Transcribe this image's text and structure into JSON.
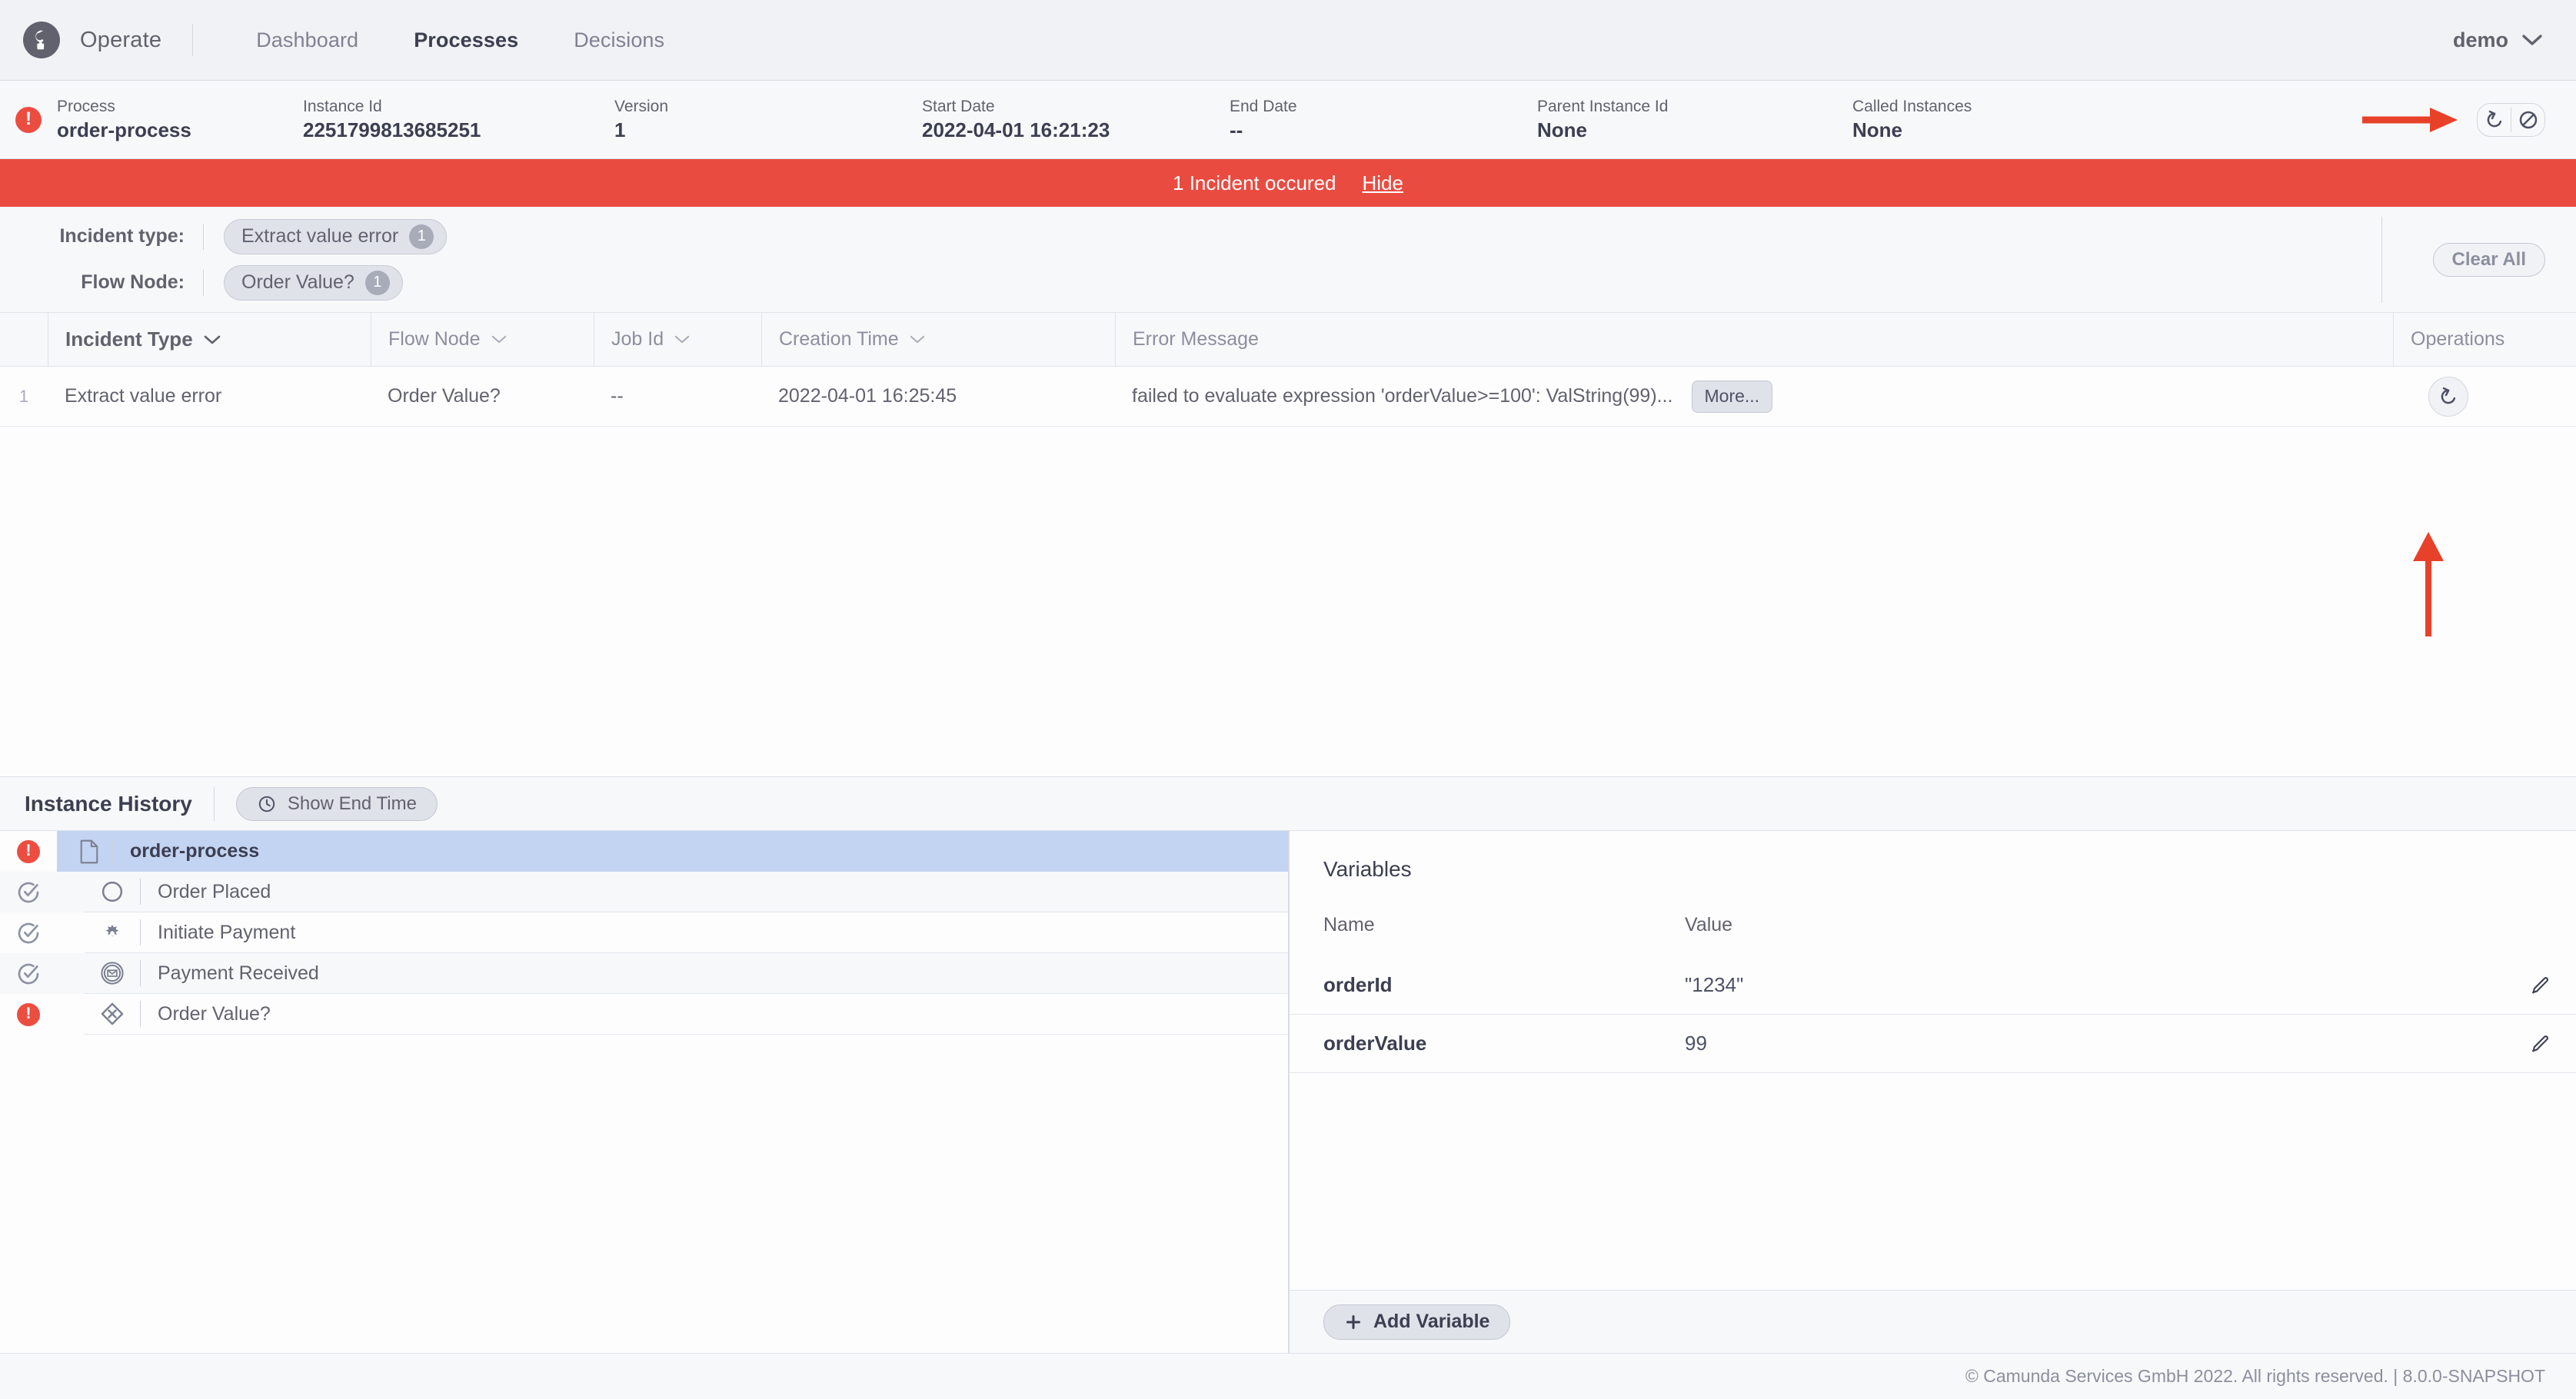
{
  "topnav": {
    "logo_icon": "camunda-logo-icon",
    "brand": "Operate",
    "links": [
      {
        "label": "Dashboard",
        "active": false
      },
      {
        "label": "Processes",
        "active": true
      },
      {
        "label": "Decisions",
        "active": false
      }
    ],
    "user": "demo",
    "user_chevron_icon": "chevron-down-icon"
  },
  "instance_header": {
    "state_icon": "incident-error-icon",
    "fields": [
      {
        "label": "Process",
        "value": "order-process"
      },
      {
        "label": "Instance Id",
        "value": "2251799813685251"
      },
      {
        "label": "Version",
        "value": "1"
      },
      {
        "label": "Start Date",
        "value": "2022-04-01 16:21:23"
      },
      {
        "label": "End Date",
        "value": "--"
      },
      {
        "label": "Parent Instance Id",
        "value": "None"
      },
      {
        "label": "Called Instances",
        "value": "None"
      }
    ],
    "retry_icon": "retry-icon",
    "cancel_icon": "cancel-circle-slash-icon"
  },
  "banner": {
    "text": "1 Incident occured",
    "hide_label": "Hide",
    "color": "#ea4b41"
  },
  "filters": {
    "rows": [
      {
        "label": "Incident type:",
        "pill_label": "Extract value error",
        "pill_count": "1"
      },
      {
        "label": "Flow Node:",
        "pill_label": "Order Value?",
        "pill_count": "1"
      }
    ],
    "clear_all_label": "Clear All"
  },
  "incidents_table": {
    "columns": [
      {
        "key": "num",
        "label": "",
        "sortable": false
      },
      {
        "key": "type",
        "label": "Incident Type",
        "sorted": true
      },
      {
        "key": "node",
        "label": "Flow Node",
        "sorted": false
      },
      {
        "key": "job",
        "label": "Job Id",
        "sorted": false
      },
      {
        "key": "time",
        "label": "Creation Time",
        "sorted": false
      },
      {
        "key": "msg",
        "label": "Error Message",
        "sortable": false
      },
      {
        "key": "ops",
        "label": "Operations",
        "sortable": false
      }
    ],
    "rows": [
      {
        "num": "1",
        "type": "Extract value error",
        "node": "Order Value?",
        "job": "--",
        "time": "2022-04-01 16:25:45",
        "msg": "failed to evaluate expression 'orderValue>=100': ValString(99)...",
        "more_label": "More...",
        "op_icon": "retry-icon"
      }
    ]
  },
  "bottom": {
    "history_title": "Instance History",
    "show_end_time_label": "Show End Time",
    "clock_icon": "clock-icon",
    "history_rows": [
      {
        "label": "order-process",
        "state": "incident",
        "icon": "process-document-icon",
        "selected": true,
        "level": 0
      },
      {
        "label": "Order Placed",
        "state": "completed",
        "icon": "start-event-icon",
        "selected": false,
        "level": 1
      },
      {
        "label": "Initiate Payment",
        "state": "completed",
        "icon": "service-task-gear-icon",
        "selected": false,
        "level": 1
      },
      {
        "label": "Payment Received",
        "state": "completed",
        "icon": "message-event-icon",
        "selected": false,
        "level": 1
      },
      {
        "label": "Order Value?",
        "state": "incident",
        "icon": "exclusive-gateway-icon",
        "selected": false,
        "level": 1
      }
    ],
    "variables": {
      "title": "Variables",
      "col_name": "Name",
      "col_value": "Value",
      "rows": [
        {
          "name": "orderId",
          "value": "\"1234\"",
          "edit_icon": "pencil-edit-icon"
        },
        {
          "name": "orderValue",
          "value": "99",
          "edit_icon": "pencil-edit-icon"
        }
      ],
      "add_label": "Add Variable",
      "add_icon": "plus-icon"
    }
  },
  "footer": {
    "text": "© Camunda Services GmbH 2022. All rights reserved. | 8.0.0-SNAPSHOT"
  },
  "annotations": {
    "arrow_color": "#e8412a",
    "horizontal_arrow": "arrow-right-annotation",
    "vertical_arrow": "arrow-up-annotation"
  }
}
